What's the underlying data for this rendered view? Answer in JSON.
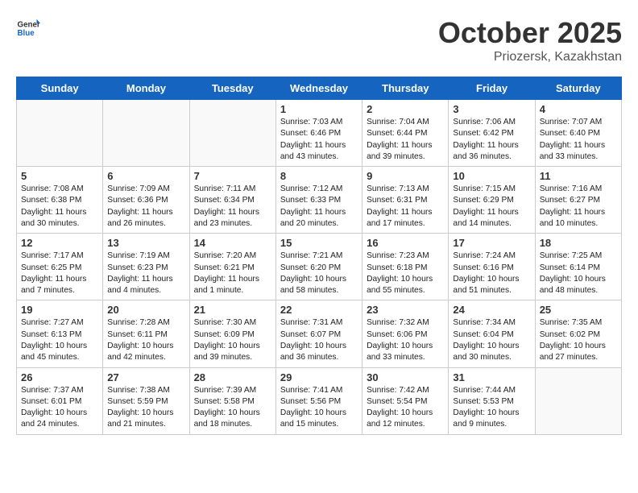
{
  "logo": {
    "general": "General",
    "blue": "Blue"
  },
  "title": "October 2025",
  "location": "Priozersk, Kazakhstan",
  "weekdays": [
    "Sunday",
    "Monday",
    "Tuesday",
    "Wednesday",
    "Thursday",
    "Friday",
    "Saturday"
  ],
  "weeks": [
    [
      {
        "day": "",
        "info": ""
      },
      {
        "day": "",
        "info": ""
      },
      {
        "day": "",
        "info": ""
      },
      {
        "day": "1",
        "info": "Sunrise: 7:03 AM\nSunset: 6:46 PM\nDaylight: 11 hours\nand 43 minutes."
      },
      {
        "day": "2",
        "info": "Sunrise: 7:04 AM\nSunset: 6:44 PM\nDaylight: 11 hours\nand 39 minutes."
      },
      {
        "day": "3",
        "info": "Sunrise: 7:06 AM\nSunset: 6:42 PM\nDaylight: 11 hours\nand 36 minutes."
      },
      {
        "day": "4",
        "info": "Sunrise: 7:07 AM\nSunset: 6:40 PM\nDaylight: 11 hours\nand 33 minutes."
      }
    ],
    [
      {
        "day": "5",
        "info": "Sunrise: 7:08 AM\nSunset: 6:38 PM\nDaylight: 11 hours\nand 30 minutes."
      },
      {
        "day": "6",
        "info": "Sunrise: 7:09 AM\nSunset: 6:36 PM\nDaylight: 11 hours\nand 26 minutes."
      },
      {
        "day": "7",
        "info": "Sunrise: 7:11 AM\nSunset: 6:34 PM\nDaylight: 11 hours\nand 23 minutes."
      },
      {
        "day": "8",
        "info": "Sunrise: 7:12 AM\nSunset: 6:33 PM\nDaylight: 11 hours\nand 20 minutes."
      },
      {
        "day": "9",
        "info": "Sunrise: 7:13 AM\nSunset: 6:31 PM\nDaylight: 11 hours\nand 17 minutes."
      },
      {
        "day": "10",
        "info": "Sunrise: 7:15 AM\nSunset: 6:29 PM\nDaylight: 11 hours\nand 14 minutes."
      },
      {
        "day": "11",
        "info": "Sunrise: 7:16 AM\nSunset: 6:27 PM\nDaylight: 11 hours\nand 10 minutes."
      }
    ],
    [
      {
        "day": "12",
        "info": "Sunrise: 7:17 AM\nSunset: 6:25 PM\nDaylight: 11 hours\nand 7 minutes."
      },
      {
        "day": "13",
        "info": "Sunrise: 7:19 AM\nSunset: 6:23 PM\nDaylight: 11 hours\nand 4 minutes."
      },
      {
        "day": "14",
        "info": "Sunrise: 7:20 AM\nSunset: 6:21 PM\nDaylight: 11 hours\nand 1 minute."
      },
      {
        "day": "15",
        "info": "Sunrise: 7:21 AM\nSunset: 6:20 PM\nDaylight: 10 hours\nand 58 minutes."
      },
      {
        "day": "16",
        "info": "Sunrise: 7:23 AM\nSunset: 6:18 PM\nDaylight: 10 hours\nand 55 minutes."
      },
      {
        "day": "17",
        "info": "Sunrise: 7:24 AM\nSunset: 6:16 PM\nDaylight: 10 hours\nand 51 minutes."
      },
      {
        "day": "18",
        "info": "Sunrise: 7:25 AM\nSunset: 6:14 PM\nDaylight: 10 hours\nand 48 minutes."
      }
    ],
    [
      {
        "day": "19",
        "info": "Sunrise: 7:27 AM\nSunset: 6:13 PM\nDaylight: 10 hours\nand 45 minutes."
      },
      {
        "day": "20",
        "info": "Sunrise: 7:28 AM\nSunset: 6:11 PM\nDaylight: 10 hours\nand 42 minutes."
      },
      {
        "day": "21",
        "info": "Sunrise: 7:30 AM\nSunset: 6:09 PM\nDaylight: 10 hours\nand 39 minutes."
      },
      {
        "day": "22",
        "info": "Sunrise: 7:31 AM\nSunset: 6:07 PM\nDaylight: 10 hours\nand 36 minutes."
      },
      {
        "day": "23",
        "info": "Sunrise: 7:32 AM\nSunset: 6:06 PM\nDaylight: 10 hours\nand 33 minutes."
      },
      {
        "day": "24",
        "info": "Sunrise: 7:34 AM\nSunset: 6:04 PM\nDaylight: 10 hours\nand 30 minutes."
      },
      {
        "day": "25",
        "info": "Sunrise: 7:35 AM\nSunset: 6:02 PM\nDaylight: 10 hours\nand 27 minutes."
      }
    ],
    [
      {
        "day": "26",
        "info": "Sunrise: 7:37 AM\nSunset: 6:01 PM\nDaylight: 10 hours\nand 24 minutes."
      },
      {
        "day": "27",
        "info": "Sunrise: 7:38 AM\nSunset: 5:59 PM\nDaylight: 10 hours\nand 21 minutes."
      },
      {
        "day": "28",
        "info": "Sunrise: 7:39 AM\nSunset: 5:58 PM\nDaylight: 10 hours\nand 18 minutes."
      },
      {
        "day": "29",
        "info": "Sunrise: 7:41 AM\nSunset: 5:56 PM\nDaylight: 10 hours\nand 15 minutes."
      },
      {
        "day": "30",
        "info": "Sunrise: 7:42 AM\nSunset: 5:54 PM\nDaylight: 10 hours\nand 12 minutes."
      },
      {
        "day": "31",
        "info": "Sunrise: 7:44 AM\nSunset: 5:53 PM\nDaylight: 10 hours\nand 9 minutes."
      },
      {
        "day": "",
        "info": ""
      }
    ]
  ]
}
